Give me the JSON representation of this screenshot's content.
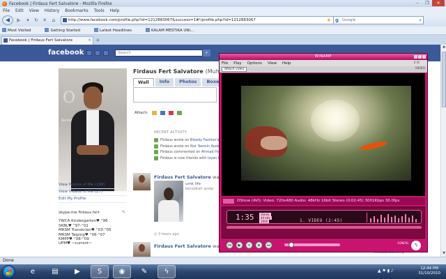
{
  "firefox": {
    "title": "Facebook | Firdaus Fert Salvatore - Mozilla Firefox",
    "window_buttons": [
      "–",
      "❐",
      "✕"
    ],
    "menu": [
      "File",
      "Edit",
      "View",
      "History",
      "Bookmarks",
      "Tools",
      "Help"
    ],
    "url": "http://www.facebook.com/profile.php?id=1212883067&success=1#!/profile.php?id=1212883067",
    "search_provider": "g",
    "search_placeholder": "Google",
    "bookmarks": [
      "Most Visited",
      "Getting Started",
      "Latest Headlines",
      "KALAM MESTIKA UNI..."
    ],
    "tab_title": "Facebook | Firdaus Fert Salvatore",
    "status_text": "Done"
  },
  "facebook": {
    "logo": "facebook",
    "search_placeholder": "Search",
    "profile_name": "Firdaus Fert Salvatore",
    "profile_name_suffix": "(Muham",
    "tabs": [
      "Wall",
      "Info",
      "Photos",
      "Boxes"
    ],
    "attach_label": "Attach:",
    "photo_overlay_letter": "O",
    "photo_overlay_text": "Suicide Me",
    "side_links": [
      "View Photos of Me (298)",
      "View Videos of Me (27)",
      "Edit My Profile"
    ],
    "skype": "skype:me firdaus.fert",
    "edit_icon": "✎",
    "education": [
      "YWCA Kindergarten♥ ''96",
      "SKBL♥ ''97-''02",
      "MRSM Transkrian♥ ''03-''05",
      "MRSM Taiping♥ ''06-''07",
      "KMPP♥ ''08-''09",
      "UPM♥ ~current~"
    ],
    "recent_heading": "RECENT ACTIVITY",
    "recent": [
      {
        "pre": "Firdaus wrote on ",
        "link": "Bloody Fashion's"
      },
      {
        "pre": "Firdaus wrote on ",
        "link": "Nur Yasmin Ayob"
      },
      {
        "pre": "Firdaus commented on ",
        "link": "Ahmad Har"
      },
      {
        "pre": "Firdaus is now friends with ",
        "link": "Izyan M"
      }
    ],
    "post1_name": "Firdaus Fert Salvatore",
    "post1_rest": " was ta",
    "post1_photo_title": "umk life",
    "post1_photo_sub": "kenalkah anda",
    "post1_time": "3 hours ago",
    "post2_name": "Firdaus Fert Salvatore",
    "post2_rest": " was ta",
    "right_footer": "mvdeal.com.my"
  },
  "winamp": {
    "title": "WINAMP",
    "menu": [
      "File",
      "Play",
      "Options",
      "View",
      "Help"
    ],
    "menu_right": "3 IS",
    "attach_button": "Attach video",
    "sub_right": "VIDEO",
    "status": "DShow (AVI): Video: 720x480 Audio: 48kHz 16bit Stereo (0:02:45) 3001Kbps 30.0fps",
    "time": "1:35",
    "info_labels": [
      "stereo",
      "44 kHz",
      "1600"
    ],
    "track": "1. VIDEO (2:45)",
    "controls": [
      "⏮",
      "▶",
      "⏸",
      "⏹",
      "⏭"
    ],
    "config": "CONFIG",
    "logo": "ϟ"
  },
  "taskbar": {
    "items": [
      "folder-icon",
      "media-player-icon",
      "firefox-icon",
      "skype-icon",
      "winamp-icon"
    ],
    "time": "12:44 PM",
    "date": "31/10/2010"
  }
}
